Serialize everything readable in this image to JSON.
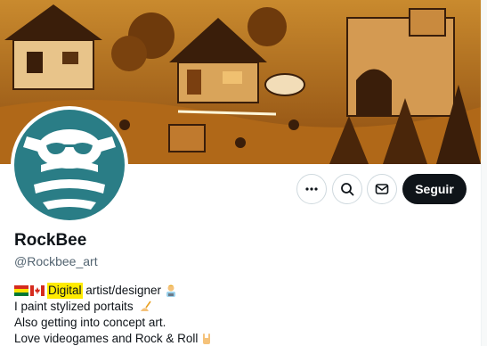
{
  "profile": {
    "display_name": "RockBee",
    "handle": "@Rockbee_art"
  },
  "actions": {
    "follow_label": "Seguir"
  },
  "bio": {
    "line1_pre": "",
    "line1_highlight": "Digital",
    "line1_post": " artist/designer",
    "line2": "I paint stylized portaits",
    "line3": "Also getting into concept art.",
    "line4": "Love videogames and Rock & Roll"
  },
  "icons": {
    "more": "more-horizontal-icon",
    "search": "search-icon",
    "message": "envelope-icon",
    "flags": [
      "bolivia-flag-icon",
      "canada-flag-icon"
    ],
    "artist": "artist-emoji-icon",
    "writing_hand": "writing-hand-icon",
    "rock_hand": "rock-hand-icon"
  },
  "colors": {
    "brand_teal": "#2a7d86",
    "highlight": "#ffeb00",
    "follow_bg": "#0f1419"
  }
}
